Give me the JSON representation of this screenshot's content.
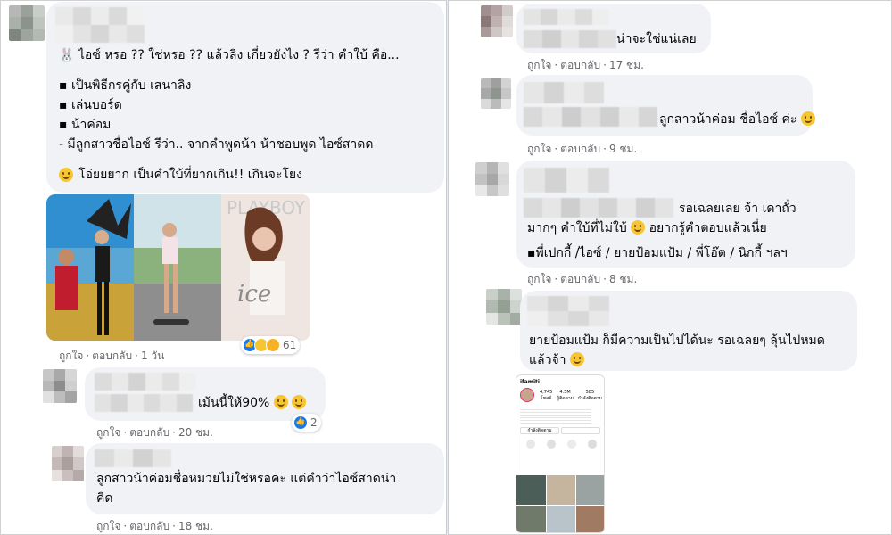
{
  "left": {
    "comment1": {
      "lines": [
        "🐰 ไอซ์ หรอ ?? ใช่หรอ ?? แล้วลิง เกี่ยวยังไง ? รีว่า คำใบ้ คือ...",
        "▪ เป็นพิธีกรคู่กับ เสนาลิง",
        "▪ เล่นบอร์ด",
        "▪ น้าค่อม",
        "- มีลูกสาวชื่อไอซ์ รีว่า.. จากคำพูดน้า น้าชอบพูด ไอซ์สาดด",
        "โอ่ยยยาก เป็นคำใบ้ที่ยากเกิน!! เกินจะโยง"
      ],
      "reaction_count": "61",
      "meta": {
        "like": "ถูกใจ",
        "reply": "ตอบกลับ",
        "time": "1 วัน"
      }
    },
    "comment2": {
      "text": "เม้นนี้ให้90%",
      "reaction_count": "2",
      "meta": {
        "like": "ถูกใจ",
        "reply": "ตอบกลับ",
        "time": "20 ชม."
      }
    },
    "comment3": {
      "lines": [
        "ลูกสาวน้าค่อมชื่อหมวยไม่ใช่หรอคะ แต่คำว่าไอซ์สาดน่า",
        "คิด"
      ],
      "meta": {
        "like": "ถูกใจ",
        "reply": "ตอบกลับ",
        "time": "18 ชม."
      }
    }
  },
  "right": {
    "comment1": {
      "text": "น่าจะใช่แน่เลย",
      "meta": {
        "like": "ถูกใจ",
        "reply": "ตอบกลับ",
        "time": "17 ชม."
      }
    },
    "comment2": {
      "text": "ลูกสาวน้าค่อม ชื่อไอซ์ ค่ะ",
      "meta": {
        "like": "ถูกใจ",
        "reply": "ตอบกลับ",
        "time": "9 ชม."
      }
    },
    "comment3": {
      "lines": [
        "รอเฉลยเลย จ้า เดาถั่ว",
        "มากๆ คำใบ้ที่ไม่ใบ้",
        "อยากรู้คำตอบแล้วเนี่ย",
        "▪พี่เปกกี้ /ไอซ์ / ยายป้อมแป้ม / พี่โอ๊ต / นิกกี้ ฯลฯ"
      ],
      "meta": {
        "like": "ถูกใจ",
        "reply": "ตอบกลับ",
        "time": "8 ชม."
      }
    },
    "comment4": {
      "lines": [
        "ยายป้อมแป้ม ก็มีความเป็นไปได้นะ รอเฉลยๆ ลุ้นไปหมด",
        "แล้วจ้า"
      ],
      "meta": {
        "like": "ถูกใจ",
        "reply": "ตอบกลับ",
        "time": ""
      }
    },
    "instagram": {
      "username": "ifamiti",
      "stats": [
        {
          "value": "4,745",
          "label": "โพสต์"
        },
        {
          "value": "4.5M",
          "label": "ผู้ติดตาม"
        },
        {
          "value": "585",
          "label": "กำลังติดตาม"
        }
      ],
      "button_label": "กำลังติดตาม"
    }
  },
  "colors": {
    "bubble": "#f0f2f5",
    "meta": "#65676b",
    "like_blue": "#1877f2",
    "haha_yellow": "#f7c531"
  }
}
